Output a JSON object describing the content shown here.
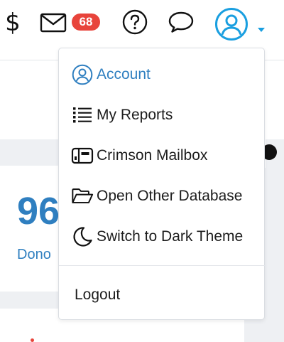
{
  "header": {
    "dollar_symbol": "$",
    "unread_count": "68"
  },
  "background": {
    "big_number": "96",
    "donor_label": "Dono"
  },
  "menu": {
    "items": [
      {
        "label": "Account",
        "icon": "user-circle-icon"
      },
      {
        "label": "My Reports",
        "icon": "list-icon"
      },
      {
        "label": "Crimson Mailbox",
        "icon": "mailbox-icon"
      },
      {
        "label": "Open Other Database",
        "icon": "folder-open-icon"
      },
      {
        "label": "Switch to Dark Theme",
        "icon": "moon-icon"
      }
    ],
    "logout_label": "Logout"
  },
  "colors": {
    "accent": "#2f7fc0",
    "badge": "#e8443b",
    "avatar": "#1a9fe0"
  }
}
